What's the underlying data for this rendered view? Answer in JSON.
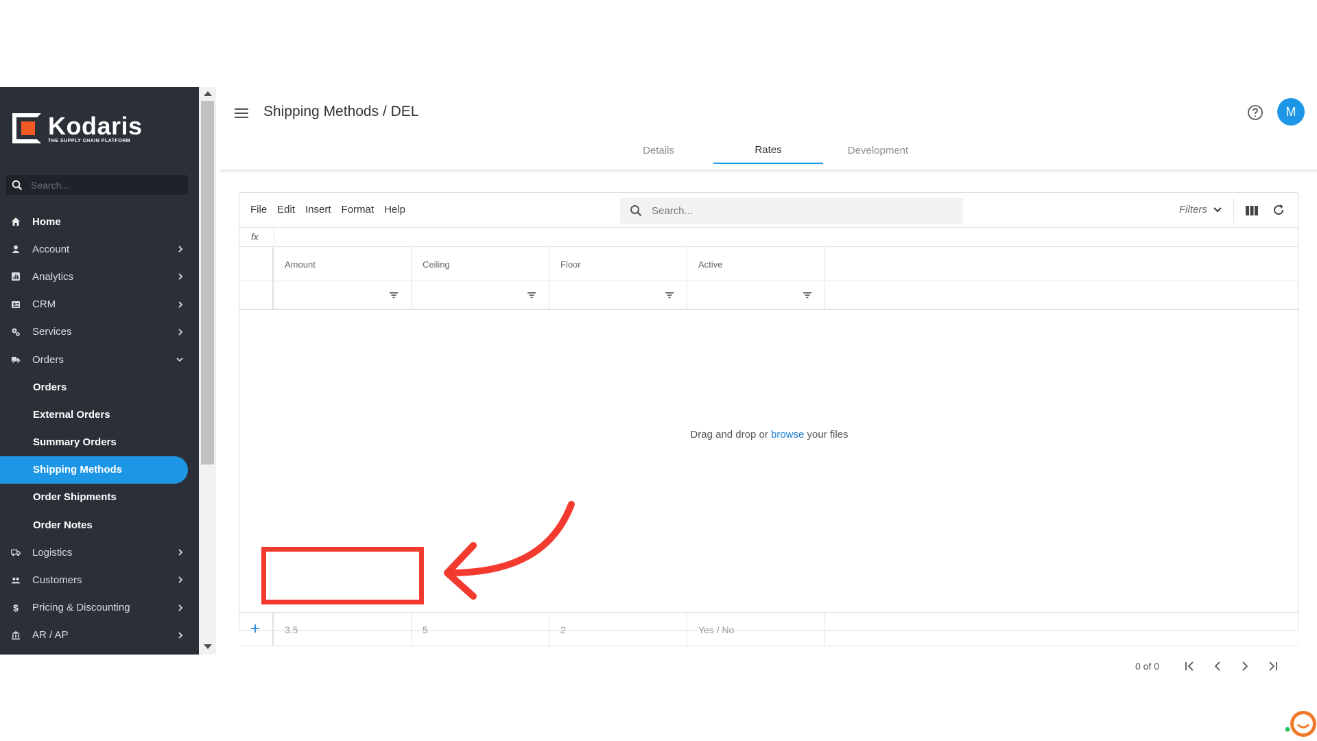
{
  "app": {
    "logo_name": "Kodaris",
    "logo_tagline": "THE SUPPLY CHAIN PLATFORM",
    "page_title": "Shipping Methods / DEL",
    "avatar_initial": "M",
    "accent_color": "#1e96e6"
  },
  "sidebar": {
    "search_placeholder": "Search...",
    "items": [
      {
        "label": "Home",
        "icon": "home-icon",
        "has_chevron": false
      },
      {
        "label": "Account",
        "icon": "user-icon",
        "has_chevron": true
      },
      {
        "label": "Analytics",
        "icon": "chart-icon",
        "has_chevron": true
      },
      {
        "label": "CRM",
        "icon": "contact-card-icon",
        "has_chevron": true
      },
      {
        "label": "Services",
        "icon": "gears-icon",
        "has_chevron": true
      },
      {
        "label": "Orders",
        "icon": "truck-icon",
        "has_chevron": true,
        "expanded": true
      }
    ],
    "orders_sub": [
      {
        "label": "Orders"
      },
      {
        "label": "External Orders"
      },
      {
        "label": "Summary Orders"
      },
      {
        "label": "Shipping Methods",
        "active": true
      },
      {
        "label": "Order Shipments"
      },
      {
        "label": "Order Notes"
      }
    ],
    "items_after": [
      {
        "label": "Logistics",
        "icon": "shipping-icon"
      },
      {
        "label": "Customers",
        "icon": "users-icon"
      },
      {
        "label": "Pricing & Discounting",
        "icon": "dollar-icon"
      },
      {
        "label": "AR / AP",
        "icon": "bank-icon"
      }
    ]
  },
  "tabs": [
    {
      "label": "Details",
      "active": false
    },
    {
      "label": "Rates",
      "active": true
    },
    {
      "label": "Development",
      "active": false
    }
  ],
  "toolbar": {
    "menus": [
      "File",
      "Edit",
      "Insert",
      "Format",
      "Help"
    ],
    "search_placeholder": "Search...",
    "filters_label": "Filters"
  },
  "formula_bar": {
    "label": "fx"
  },
  "grid": {
    "columns": [
      "Amount",
      "Ceiling",
      "Floor",
      "Active"
    ],
    "new_row": [
      "3.5",
      "5",
      "2",
      "Yes / No"
    ],
    "empty_message_before": "Drag and drop or ",
    "empty_message_link": "browse",
    "empty_message_after": " your files"
  },
  "pager": {
    "count": "0 of 0"
  },
  "annotation": {
    "color": "#f23a2e"
  }
}
